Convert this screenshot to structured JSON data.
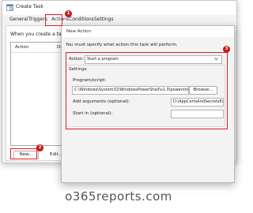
{
  "create_task": {
    "title": "Create Task",
    "tabs": [
      "General",
      "Triggers",
      "Actions",
      "Conditions",
      "Settings"
    ],
    "description": "When you create a task, yo",
    "list_columns": [
      "Action",
      "De"
    ],
    "buttons": {
      "new": "New...",
      "edit": "Edit..."
    }
  },
  "new_action": {
    "title": "New Action",
    "message": "You must specify what action this task will perform.",
    "action_label": "Action:",
    "action_value": "Start a program",
    "settings_label": "Settings",
    "program_label": "Program/script:",
    "program_value": "C:\\Windows\\System32\\WindowsPowerShell\\v1.0\\powershe",
    "browse_label": "Browse...",
    "args_label": "Add arguments (optional):",
    "args_value": "D:\\AppCertsAndSecretsEx",
    "start_label": "Start in (optional):",
    "start_value": ""
  },
  "annotations": {
    "badge_1": "1",
    "badge_2": "2",
    "badge_3": "3"
  },
  "watermark": "o365reports.com",
  "colors": {
    "highlight": "#e02020",
    "badge": "#c81818"
  }
}
